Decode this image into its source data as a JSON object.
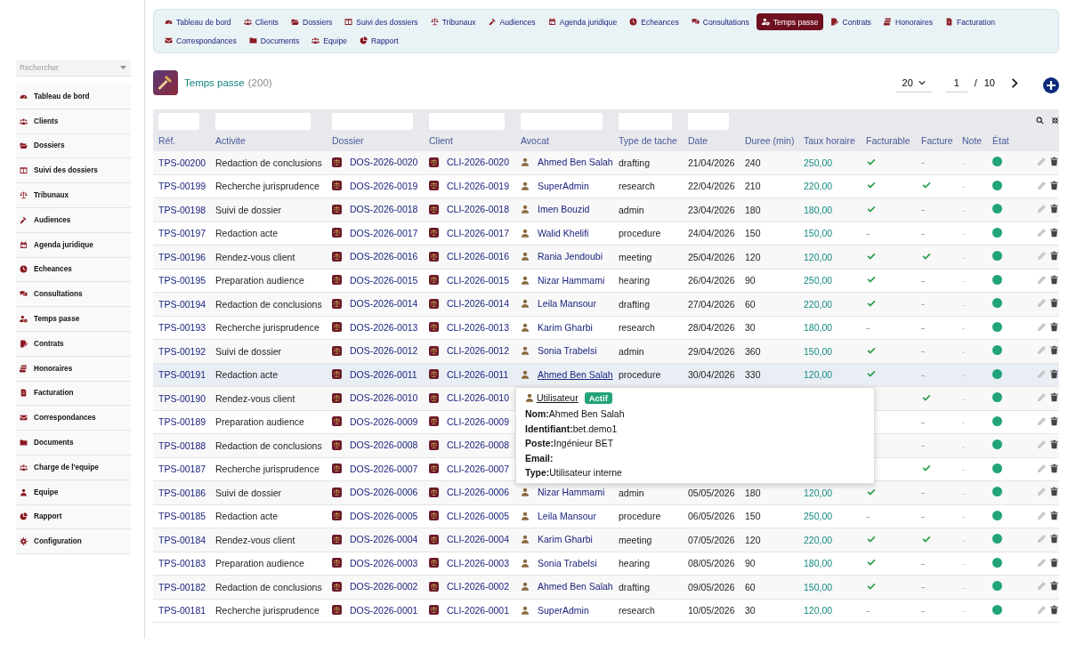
{
  "sidebar": {
    "search_placeholder": "Rechercher",
    "items": [
      {
        "label": "Tableau de bord"
      },
      {
        "label": "Clients"
      },
      {
        "label": "Dossiers"
      },
      {
        "label": "Suivi des dossiers"
      },
      {
        "label": "Tribunaux"
      },
      {
        "label": "Audiences"
      },
      {
        "label": "Agenda juridique"
      },
      {
        "label": "Echeances"
      },
      {
        "label": "Consultations"
      },
      {
        "label": "Temps passe"
      },
      {
        "label": "Contrats"
      },
      {
        "label": "Honoraires"
      },
      {
        "label": "Facturation"
      },
      {
        "label": "Correspondances"
      },
      {
        "label": "Documents"
      },
      {
        "label": "Charge de l'equipe"
      },
      {
        "label": "Equipe"
      },
      {
        "label": "Rapport"
      },
      {
        "label": "Configuration"
      }
    ]
  },
  "nav": {
    "items": [
      {
        "label": "Tableau de bord",
        "selected": false
      },
      {
        "label": "Clients",
        "selected": false
      },
      {
        "label": "Dossiers",
        "selected": false
      },
      {
        "label": "Suivi des dossiers",
        "selected": false
      },
      {
        "label": "Tribunaux",
        "selected": false
      },
      {
        "label": "Audiences",
        "selected": false
      },
      {
        "label": "Agenda juridique",
        "selected": false
      },
      {
        "label": "Echeances",
        "selected": false
      },
      {
        "label": "Consultations",
        "selected": false
      },
      {
        "label": "Temps passe",
        "selected": true
      },
      {
        "label": "Contrats",
        "selected": false
      },
      {
        "label": "Honoraires",
        "selected": false
      },
      {
        "label": "Facturation",
        "selected": false
      },
      {
        "label": "Correspondances",
        "selected": false
      },
      {
        "label": "Documents",
        "selected": false
      },
      {
        "label": "Equipe",
        "selected": false
      },
      {
        "label": "Rapport",
        "selected": false
      }
    ]
  },
  "page": {
    "title": "Temps passe",
    "count": "(200)"
  },
  "pagination": {
    "page_size": "20",
    "page": "1",
    "separator": "/",
    "total_pages": "10"
  },
  "table": {
    "columns": [
      "Réf.",
      "Activite",
      "Dossier",
      "Client",
      "Avocat",
      "Type de tache",
      "Date",
      "Duree (min)",
      "Taux horaire",
      "Facturable",
      "Facture",
      "Note",
      "État"
    ],
    "rows": [
      {
        "ref": "TPS-00200",
        "activite": "Redaction de conclusions",
        "dossier": "DOS-2026-0020",
        "client": "CLI-2026-0020",
        "avocat": "Ahmed Ben Salah",
        "type": "drafting",
        "date": "21/04/2026",
        "duree": "240",
        "taux": "250,00",
        "facturable": true,
        "facture": false,
        "note": "-",
        "active": true,
        "highlighted": false
      },
      {
        "ref": "TPS-00199",
        "activite": "Recherche jurisprudence",
        "dossier": "DOS-2026-0019",
        "client": "CLI-2026-0019",
        "avocat": "SuperAdmin",
        "type": "research",
        "date": "22/04/2026",
        "duree": "210",
        "taux": "220,00",
        "facturable": true,
        "facture": true,
        "note": "-",
        "active": true,
        "highlighted": false
      },
      {
        "ref": "TPS-00198",
        "activite": "Suivi de dossier",
        "dossier": "DOS-2026-0018",
        "client": "CLI-2026-0018",
        "avocat": "Imen Bouzid",
        "type": "admin",
        "date": "23/04/2026",
        "duree": "180",
        "taux": "180,00",
        "facturable": true,
        "facture": false,
        "note": "-",
        "active": true,
        "highlighted": false
      },
      {
        "ref": "TPS-00197",
        "activite": "Redaction acte",
        "dossier": "DOS-2026-0017",
        "client": "CLI-2026-0017",
        "avocat": "Walid Khelifi",
        "type": "procedure",
        "date": "24/04/2026",
        "duree": "150",
        "taux": "150,00",
        "facturable": false,
        "facture": false,
        "note": "-",
        "active": true,
        "highlighted": false
      },
      {
        "ref": "TPS-00196",
        "activite": "Rendez-vous client",
        "dossier": "DOS-2026-0016",
        "client": "CLI-2026-0016",
        "avocat": "Rania Jendoubi",
        "type": "meeting",
        "date": "25/04/2026",
        "duree": "120",
        "taux": "120,00",
        "facturable": true,
        "facture": true,
        "note": "-",
        "active": true,
        "highlighted": false
      },
      {
        "ref": "TPS-00195",
        "activite": "Preparation audience",
        "dossier": "DOS-2026-0015",
        "client": "CLI-2026-0015",
        "avocat": "Nizar Hammami",
        "type": "hearing",
        "date": "26/04/2026",
        "duree": "90",
        "taux": "250,00",
        "facturable": true,
        "facture": false,
        "note": "-",
        "active": true,
        "highlighted": false
      },
      {
        "ref": "TPS-00194",
        "activite": "Redaction de conclusions",
        "dossier": "DOS-2026-0014",
        "client": "CLI-2026-0014",
        "avocat": "Leila Mansour",
        "type": "drafting",
        "date": "27/04/2026",
        "duree": "60",
        "taux": "220,00",
        "facturable": true,
        "facture": false,
        "note": "-",
        "active": true,
        "highlighted": false
      },
      {
        "ref": "TPS-00193",
        "activite": "Recherche jurisprudence",
        "dossier": "DOS-2026-0013",
        "client": "CLI-2026-0013",
        "avocat": "Karim Gharbi",
        "type": "research",
        "date": "28/04/2026",
        "duree": "30",
        "taux": "180,00",
        "facturable": false,
        "facture": false,
        "note": "-",
        "active": true,
        "highlighted": false
      },
      {
        "ref": "TPS-00192",
        "activite": "Suivi de dossier",
        "dossier": "DOS-2026-0012",
        "client": "CLI-2026-0012",
        "avocat": "Sonia Trabelsi",
        "type": "admin",
        "date": "29/04/2026",
        "duree": "360",
        "taux": "150,00",
        "facturable": true,
        "facture": false,
        "note": "-",
        "active": true,
        "highlighted": false
      },
      {
        "ref": "TPS-00191",
        "activite": "Redaction acte",
        "dossier": "DOS-2026-0011",
        "client": "CLI-2026-0011",
        "avocat": "Ahmed Ben Salah",
        "type": "procedure",
        "date": "30/04/2026",
        "duree": "330",
        "taux": "120,00",
        "facturable": true,
        "facture": false,
        "note": "-",
        "active": true,
        "highlighted": true
      },
      {
        "ref": "TPS-00190",
        "activite": "Rendez-vous client",
        "dossier": "DOS-2026-0010",
        "client": "CLI-2026-0010",
        "facture": true,
        "note": "-",
        "active": true,
        "highlighted": false
      },
      {
        "ref": "TPS-00189",
        "activite": "Preparation audience",
        "dossier": "DOS-2026-0009",
        "client": "CLI-2026-0009",
        "facture": false,
        "note": "-",
        "active": true,
        "highlighted": false
      },
      {
        "ref": "TPS-00188",
        "activite": "Redaction de conclusions",
        "dossier": "DOS-2026-0008",
        "client": "CLI-2026-0008",
        "facture": false,
        "note": "-",
        "active": true,
        "highlighted": false
      },
      {
        "ref": "TPS-00187",
        "activite": "Recherche jurisprudence",
        "dossier": "DOS-2026-0007",
        "client": "CLI-2026-0007",
        "facture": true,
        "note": "-",
        "active": true,
        "highlighted": false
      },
      {
        "ref": "TPS-00186",
        "activite": "Suivi de dossier",
        "dossier": "DOS-2026-0006",
        "client": "CLI-2026-0006",
        "avocat": "Nizar Hammami",
        "type": "admin",
        "date": "05/05/2026",
        "duree": "180",
        "taux": "120,00",
        "facturable": true,
        "facture": false,
        "note": "-",
        "active": true,
        "highlighted": false
      },
      {
        "ref": "TPS-00185",
        "activite": "Redaction acte",
        "dossier": "DOS-2026-0005",
        "client": "CLI-2026-0005",
        "avocat": "Leila Mansour",
        "type": "procedure",
        "date": "06/05/2026",
        "duree": "150",
        "taux": "250,00",
        "facturable": false,
        "facture": false,
        "note": "-",
        "active": true,
        "highlighted": false
      },
      {
        "ref": "TPS-00184",
        "activite": "Rendez-vous client",
        "dossier": "DOS-2026-0004",
        "client": "CLI-2026-0004",
        "avocat": "Karim Gharbi",
        "type": "meeting",
        "date": "07/05/2026",
        "duree": "120",
        "taux": "220,00",
        "facturable": true,
        "facture": true,
        "note": "-",
        "active": true,
        "highlighted": false
      },
      {
        "ref": "TPS-00183",
        "activite": "Preparation audience",
        "dossier": "DOS-2026-0003",
        "client": "CLI-2026-0003",
        "avocat": "Sonia Trabelsi",
        "type": "hearing",
        "date": "08/05/2026",
        "duree": "90",
        "taux": "180,00",
        "facturable": true,
        "facture": false,
        "note": "-",
        "active": true,
        "highlighted": false
      },
      {
        "ref": "TPS-00182",
        "activite": "Redaction de conclusions",
        "dossier": "DOS-2026-0002",
        "client": "CLI-2026-0002",
        "avocat": "Ahmed Ben Salah",
        "type": "drafting",
        "date": "09/05/2026",
        "duree": "60",
        "taux": "150,00",
        "facturable": true,
        "facture": false,
        "note": "-",
        "active": true,
        "highlighted": false
      },
      {
        "ref": "TPS-00181",
        "activite": "Recherche jurisprudence",
        "dossier": "DOS-2026-0001",
        "client": "CLI-2026-0001",
        "avocat": "SuperAdmin",
        "type": "research",
        "date": "10/05/2026",
        "duree": "30",
        "taux": "120,00",
        "facturable": false,
        "facture": false,
        "note": "-",
        "active": true,
        "highlighted": false
      }
    ]
  },
  "tooltip": {
    "title": "Utilisateur",
    "badge": "Actif",
    "fields": [
      {
        "label": "Nom:",
        "value": "Ahmed Ben Salah"
      },
      {
        "label": "Identifiant:",
        "value": "bet.demo1"
      },
      {
        "label": "Poste:",
        "value": "Ingénieur BET"
      },
      {
        "label": "Email:"
      },
      {
        "label": "Type:",
        "value": "Utilisateur interne"
      }
    ]
  }
}
